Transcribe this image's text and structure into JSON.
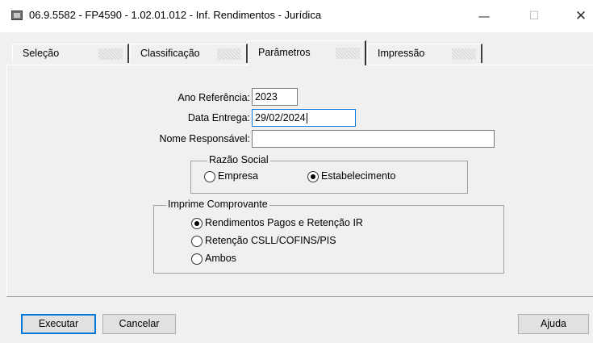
{
  "window": {
    "title": "06.9.5582 - FP4590 - 1.02.01.012 - Inf. Rendimentos - Jurídica",
    "minimize_glyph": "—",
    "maximize_glyph": "☐",
    "close_glyph": "✕"
  },
  "tabs": [
    {
      "label": "Seleção",
      "active": false
    },
    {
      "label": "Classificação",
      "active": false
    },
    {
      "label": "Parâmetros",
      "active": true
    },
    {
      "label": "Impressão",
      "active": false
    }
  ],
  "form": {
    "ano_referencia": {
      "label": "Ano Referência:",
      "value": "2023"
    },
    "data_entrega": {
      "label": "Data Entrega:",
      "value": "29/02/2024"
    },
    "nome_responsavel": {
      "label": "Nome Responsável:",
      "value": ""
    }
  },
  "razao_social": {
    "title": "Razão Social",
    "options": [
      {
        "label": "Empresa",
        "checked": false
      },
      {
        "label": "Estabelecimento",
        "checked": true
      }
    ]
  },
  "imprime_comprovante": {
    "title": "Imprime Comprovante",
    "options": [
      {
        "label": "Rendimentos Pagos e Retenção IR",
        "checked": true
      },
      {
        "label": "Retenção CSLL/COFINS/PIS",
        "checked": false
      },
      {
        "label": "Ambos",
        "checked": false
      }
    ]
  },
  "buttons": {
    "executar": "Executar",
    "cancelar": "Cancelar",
    "ajuda": "Ajuda"
  },
  "colors": {
    "background": "#f0f0f0",
    "focus_accent": "#0078d7"
  }
}
